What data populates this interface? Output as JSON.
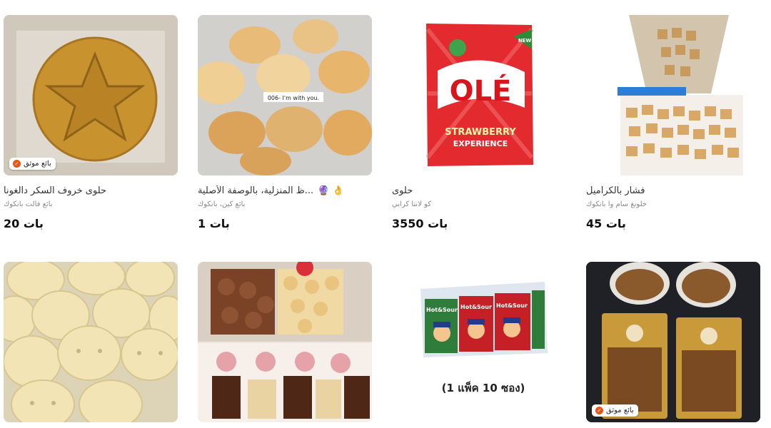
{
  "badge_label": "بائع موثق",
  "products": [
    {
      "title": "حلوى خروف السكر دالغونا",
      "seller": "بائع فالت بانكوك",
      "price": "20 بات"
    },
    {
      "title": "...ظ المنزلية، بالوصفة الأصلية",
      "seller": "بائع كين، بانكوك",
      "price": "1 بات",
      "note": "006- I'm with you."
    },
    {
      "title": "حلوى",
      "seller": "كو لانتا كرابي",
      "price": "3550 بات",
      "brand": "OLÉ",
      "flavor": "STRAWBERRY",
      "tagline": "EXPERIENCE",
      "new_tag": "NEW"
    },
    {
      "title": "فشار بالكراميل",
      "seller": "خلونغ سام وا بانكوك",
      "price": "45 بات"
    }
  ],
  "row2_caption": "(1 แพ็ค 10 ซอง)",
  "row2_pack_text": "Hot&Sour"
}
